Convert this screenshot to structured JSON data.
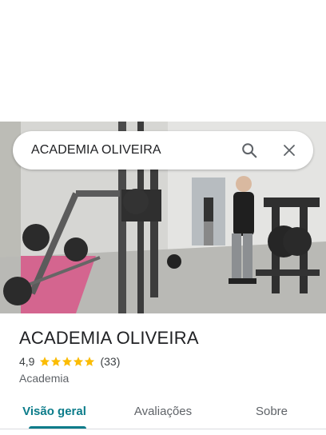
{
  "search": {
    "query": "ACADEMIA OLIVEIRA",
    "search_icon": "search-icon",
    "close_icon": "close-icon"
  },
  "place": {
    "name": "ACADEMIA OLIVEIRA",
    "rating": "4,9",
    "rating_value": 4.9,
    "stars_max": 5,
    "review_count": "(33)",
    "category": "Academia"
  },
  "tabs": [
    {
      "label": "Visão geral",
      "selected": true
    },
    {
      "label": "Avaliações",
      "selected": false
    },
    {
      "label": "Sobre",
      "selected": false
    }
  ],
  "colors": {
    "accent": "#0b7c8a",
    "star": "#fbbc04",
    "text_primary": "#202124",
    "text_secondary": "#5f6368"
  }
}
